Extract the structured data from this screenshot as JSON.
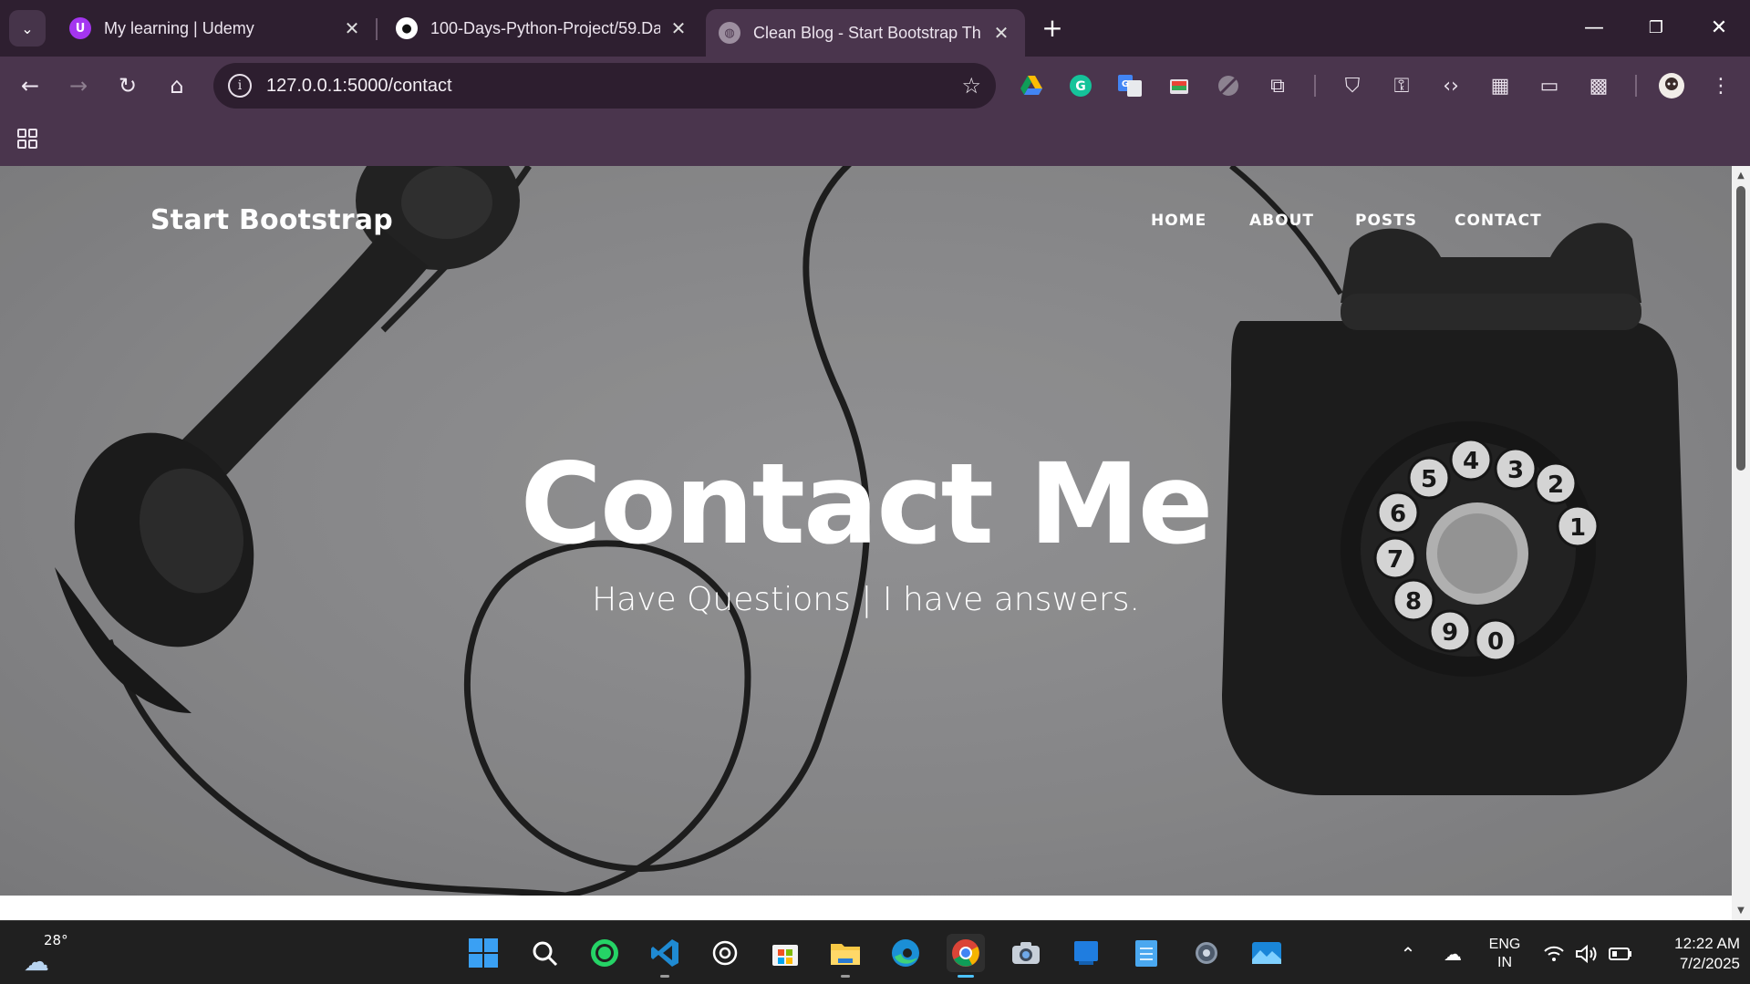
{
  "browser": {
    "tabs": [
      {
        "title": "My learning | Udemy",
        "icon": "udemy-icon",
        "active": false
      },
      {
        "title": "100-Days-Python-Project/59.Da",
        "icon": "github-icon",
        "active": false
      },
      {
        "title": "Clean Blog - Start Bootstrap Th",
        "icon": "globe-icon",
        "active": true
      }
    ],
    "address_bar": {
      "url": "127.0.0.1:5000/contact"
    },
    "accent_color": "#4a354d"
  },
  "page": {
    "brand": "Start Bootstrap",
    "nav": [
      "HOME",
      "ABOUT",
      "POSTS",
      "CONTACT"
    ],
    "heading": "Contact Me",
    "subheading": "Have Questions | I have answers."
  },
  "taskbar": {
    "weather": {
      "temp": "28°"
    },
    "apps": [
      "start-icon",
      "search-icon",
      "whatsapp-icon",
      "vscode-icon",
      "chatgpt-icon",
      "store-icon",
      "file-explorer-icon",
      "edge-icon",
      "chrome-icon",
      "camera-icon",
      "app-icon",
      "notepad-icon",
      "settings-icon",
      "photos-icon"
    ],
    "language": {
      "line1": "ENG",
      "line2": "IN"
    },
    "clock": {
      "time": "12:22 AM",
      "date": "7/2/2025"
    }
  }
}
